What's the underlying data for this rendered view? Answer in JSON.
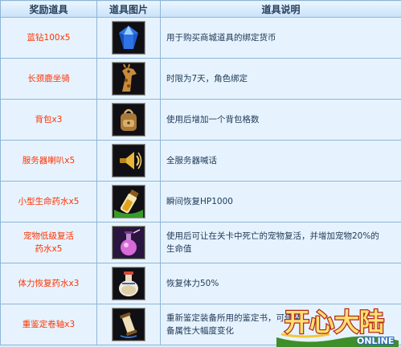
{
  "table": {
    "headers": [
      "奖励道具",
      "道具图片",
      "道具说明"
    ],
    "rows": [
      {
        "name": "蓝钻100x5",
        "icon": "blue-diamond-icon",
        "desc": "用于购买商城道具的绑定货币"
      },
      {
        "name": "长颈鹿坐骑",
        "icon": "giraffe-mount-icon",
        "desc": "时限为7天，角色绑定"
      },
      {
        "name": "背包x3",
        "icon": "backpack-icon",
        "desc": "使用后增加一个背包格数"
      },
      {
        "name": "服务器喇叭x5",
        "icon": "horn-icon",
        "desc": "全服务器喊话"
      },
      {
        "name": "小型生命药水x5",
        "icon": "health-potion-icon",
        "desc": "瞬间恢复HP1000"
      },
      {
        "name": "宠物低级复活药水x5",
        "icon": "pet-revive-potion-icon",
        "desc": "使用后可让在关卡中死亡的宠物复活，并增加宠物20%的生命值"
      },
      {
        "name": "体力恢复药水x3",
        "icon": "stamina-potion-icon",
        "desc": "恢复体力50%"
      },
      {
        "name": "重鉴定卷轴x3",
        "icon": "scroll-icon",
        "desc": "重新鉴定装备所用的鉴定书，可使装备属性大幅度变化"
      }
    ]
  },
  "logo": {
    "main": "开心大陆",
    "sub": "ONLINE"
  },
  "colors": {
    "name_text": "#ff3300",
    "border": "#8fb4d6",
    "cell_bg": "#e6f3ff"
  }
}
